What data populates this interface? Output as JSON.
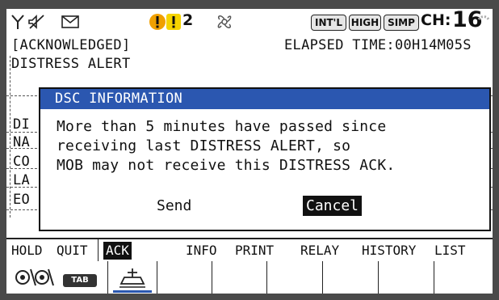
{
  "status_bar": {
    "icons": [
      "antenna-icon",
      "speaker-muted-icon",
      "envelope-icon",
      "warning-orange-icon",
      "warning-yellow-icon",
      "fan-icon",
      "busy-indicator-icon"
    ],
    "warning_count": "2",
    "mode_international": "INT'L",
    "power_high": "HIGH",
    "mode_simplex": "SIMP",
    "channel_label": "CH:",
    "channel_value": "16"
  },
  "header": {
    "status": "[ACKNOWLEDGED]",
    "elapsed": "ELAPSED TIME:00H14M05S",
    "alert_type": "DISTRESS ALERT"
  },
  "fields_partial": [
    "DI",
    "NA",
    "CO",
    "LA",
    "EO"
  ],
  "dialog": {
    "title": "DSC INFORMATION",
    "message": [
      "More than 5 minutes have passed since",
      "receiving last DISTRESS ALERT, so",
      "MOB may not receive this DISTRESS ACK."
    ],
    "send_label": "Send",
    "cancel_label": "Cancel"
  },
  "soft_keys": {
    "hold": "HOLD",
    "quit": "QUIT",
    "ack": "ACK",
    "info": "INFO",
    "print": "PRINT",
    "relay": "RELAY",
    "history": "HISTORY",
    "list": "LIST"
  },
  "bottom_bar": {
    "tab_label": "TAB",
    "icons": [
      "dial-knob-icon",
      "ship-distress-icon"
    ]
  },
  "colors": {
    "dialog_title_bg": "#2b57b0",
    "warning_orange": "#f0a000",
    "warning_yellow": "#f5d400",
    "active_key_bg": "#111111"
  }
}
